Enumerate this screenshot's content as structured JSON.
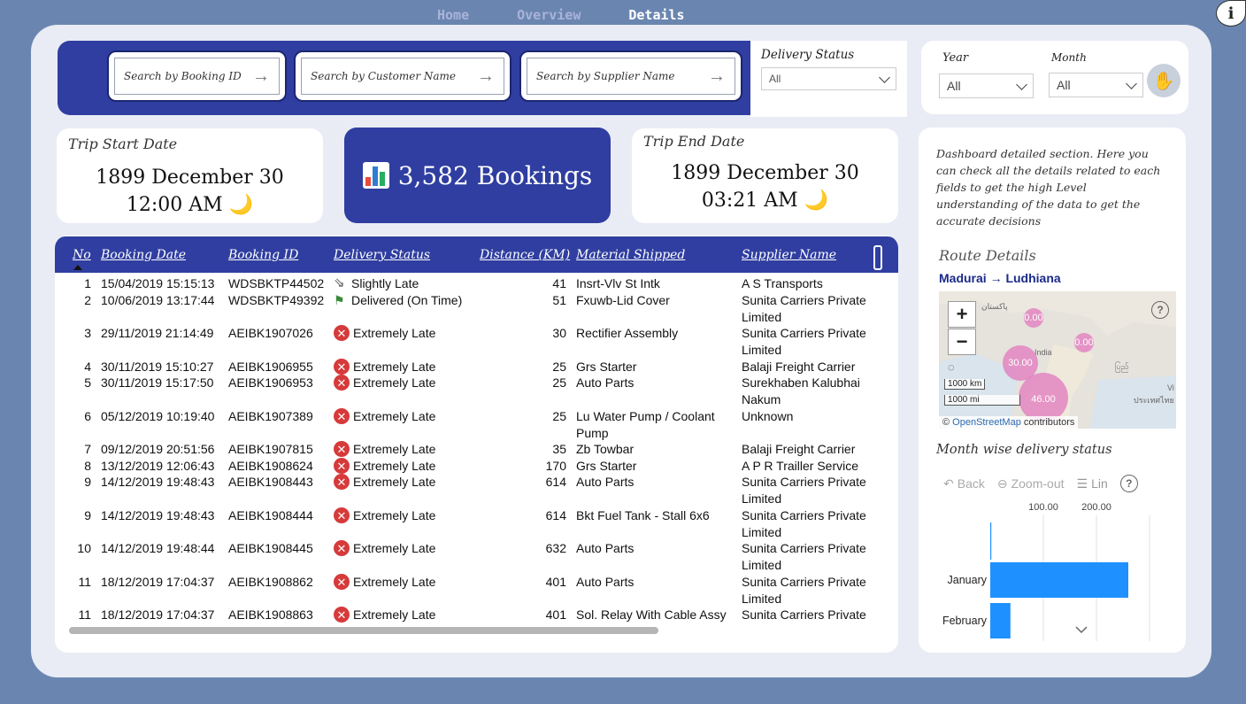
{
  "nav": {
    "tabs": [
      {
        "label": "Home"
      },
      {
        "label": "Overview"
      },
      {
        "label": "Details"
      }
    ],
    "active": "Details"
  },
  "search": {
    "booking_placeholder": "Search by Booking ID",
    "customer_placeholder": "Search by Customer Name",
    "supplier_placeholder": "Search by Supplier Name"
  },
  "filters": {
    "delivery_status_label": "Delivery Status",
    "delivery_status_value": "All",
    "year_label": "Year",
    "year_value": "All",
    "month_label": "Month",
    "month_value": "All"
  },
  "kpis": {
    "trip_start_label": "Trip Start Date",
    "trip_start_date": "1899 December 30",
    "trip_start_time": "12:00 AM",
    "bookings_label": "3,582 Bookings",
    "trip_end_label": "Trip End Date",
    "trip_end_date": "1899 December 30",
    "trip_end_time": "03:21 AM"
  },
  "table": {
    "headers": {
      "no": "No",
      "booking_date": "Booking Date",
      "booking_id": "Booking ID",
      "delivery_status": "Delivery Status",
      "distance": "Distance (KM)",
      "material": "Material Shipped",
      "supplier": "Supplier Name"
    },
    "rows": [
      {
        "no": "1",
        "date": "15/04/2019 15:15:13",
        "id": "WDSBKTP44502",
        "status": "Slightly Late",
        "dist": "41",
        "material": "Insrt-Vlv St Intk",
        "supplier": "A S Transports"
      },
      {
        "no": "2",
        "date": "10/06/2019 13:17:44",
        "id": "WDSBKTP49392",
        "status": "Delivered (On Time)",
        "dist": "51",
        "material": "Fxuwb-Lid Cover",
        "supplier": "Sunita Carriers Private Limited"
      },
      {
        "no": "3",
        "date": "29/11/2019 21:14:49",
        "id": "AEIBK1907026",
        "status": "Extremely Late",
        "dist": "30",
        "material": "Rectifier Assembly",
        "supplier": "Sunita Carriers Private Limited"
      },
      {
        "no": "4",
        "date": "30/11/2019 15:10:27",
        "id": "AEIBK1906955",
        "status": "Extremely Late",
        "dist": "25",
        "material": "Grs Starter",
        "supplier": "Balaji Freight Carrier"
      },
      {
        "no": "5",
        "date": "30/11/2019 15:17:50",
        "id": "AEIBK1906953",
        "status": "Extremely Late",
        "dist": "25",
        "material": "Auto Parts",
        "supplier": "Surekhaben Kalubhai Nakum"
      },
      {
        "no": "6",
        "date": "05/12/2019 10:19:40",
        "id": "AEIBK1907389",
        "status": "Extremely Late",
        "dist": "25",
        "material": "Lu Water Pump / Coolant Pump",
        "supplier": "Unknown"
      },
      {
        "no": "7",
        "date": "09/12/2019 20:51:56",
        "id": "AEIBK1907815",
        "status": "Extremely Late",
        "dist": "35",
        "material": "Zb Towbar",
        "supplier": "Balaji Freight Carrier"
      },
      {
        "no": "8",
        "date": "13/12/2019 12:06:43",
        "id": "AEIBK1908624",
        "status": "Extremely Late",
        "dist": "170",
        "material": "Grs Starter",
        "supplier": "A P R Trailler Service"
      },
      {
        "no": "9",
        "date": "14/12/2019 19:48:43",
        "id": "AEIBK1908443",
        "status": "Extremely Late",
        "dist": "614",
        "material": "Auto Parts",
        "supplier": "Sunita Carriers Private Limited"
      },
      {
        "no": "9",
        "date": "14/12/2019 19:48:43",
        "id": "AEIBK1908444",
        "status": "Extremely Late",
        "dist": "614",
        "material": "Bkt Fuel Tank - Stall 6x6",
        "supplier": "Sunita Carriers Private Limited"
      },
      {
        "no": "10",
        "date": "14/12/2019 19:48:44",
        "id": "AEIBK1908445",
        "status": "Extremely Late",
        "dist": "632",
        "material": "Auto Parts",
        "supplier": "Sunita Carriers Private Limited"
      },
      {
        "no": "11",
        "date": "18/12/2019 17:04:37",
        "id": "AEIBK1908862",
        "status": "Extremely Late",
        "dist": "401",
        "material": "Auto Parts",
        "supplier": "Sunita Carriers Private Limited"
      },
      {
        "no": "11",
        "date": "18/12/2019 17:04:37",
        "id": "AEIBK1908863",
        "status": "Extremely Late",
        "dist": "401",
        "material": "Sol. Relay With Cable Assy",
        "supplier": "Sunita Carriers Private"
      }
    ]
  },
  "side": {
    "description": "Dashboard detailed section. Here you can check all the details related to each fields to get the high Level understanding of the data to get the accurate decisions",
    "route_title": "Route Details",
    "route_sub": "Madurai → Ludhiana",
    "map": {
      "zoom_in": "+",
      "zoom_out": "−",
      "bubbles": [
        "0.00",
        "0.00",
        "30.00",
        "46.00"
      ],
      "labels": [
        "پاکستان",
        "India",
        "ပြည်",
        "ประเทศไทย",
        "Vi"
      ],
      "scale_km": "1000 km",
      "scale_mi": "1000 mi",
      "attrib_symbol": "©",
      "attrib_link": "OpenStreetMap",
      "attrib_text": "contributors"
    },
    "chart_title": "Month wise delivery status",
    "toolbar": {
      "back": "Back",
      "zoom_out": "Zoom-out",
      "lin": "Lin"
    }
  },
  "chart_data": {
    "type": "bar",
    "orientation": "horizontal",
    "categories": [
      "",
      "January",
      "February"
    ],
    "values": [
      2,
      260,
      38
    ],
    "xticks": [
      "100.00",
      "200.00"
    ],
    "xtick_values": [
      100,
      200
    ],
    "xlim": [
      0,
      300
    ],
    "grid": true,
    "color": "#1e90ff"
  },
  "colors": {
    "primary": "#2f3ea0",
    "background": "#6a86b0",
    "panel": "#e9ecf5",
    "late": "#d63a3a",
    "accent_tab": "#e05a6a"
  }
}
